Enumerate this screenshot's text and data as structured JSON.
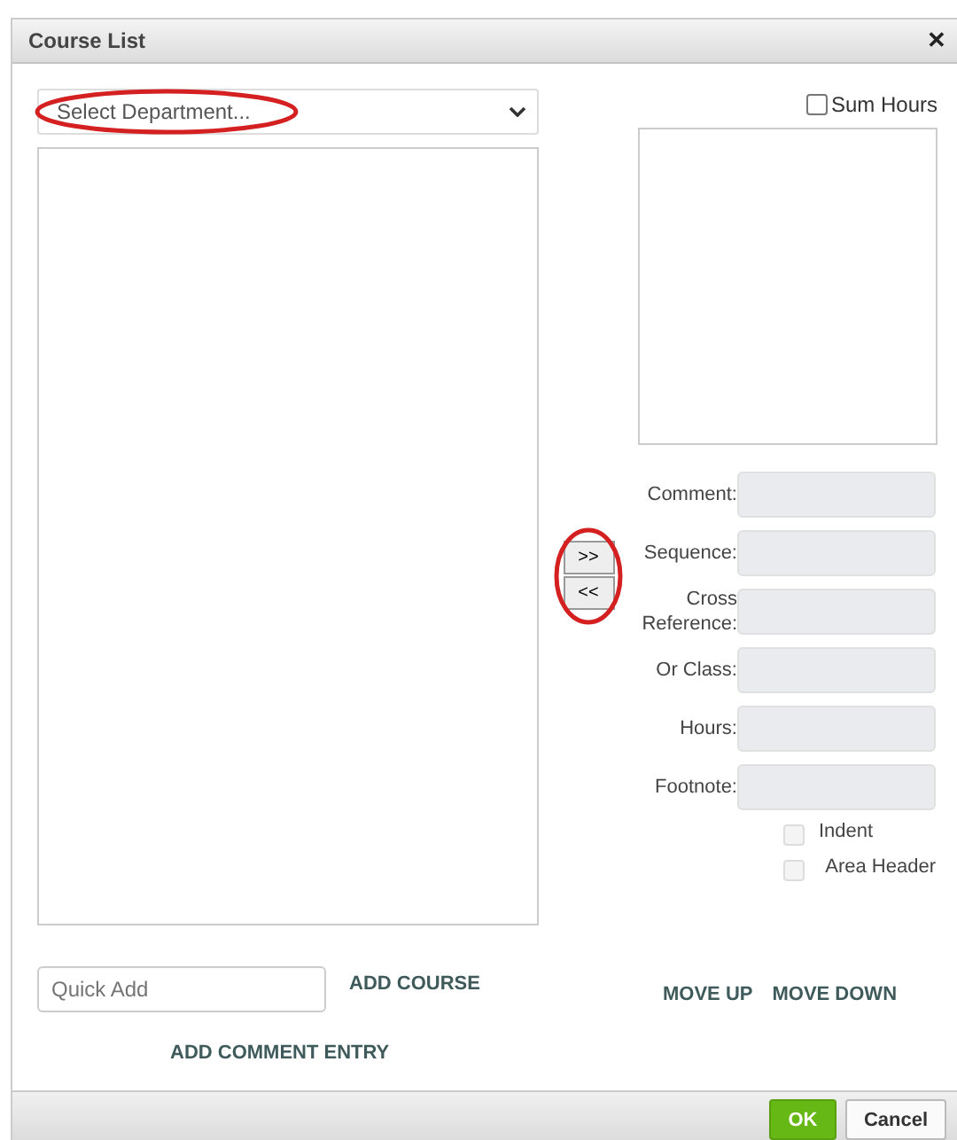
{
  "window": {
    "title": "Course List",
    "close": "✕"
  },
  "department": {
    "placeholder": "Select Department...",
    "circled": true
  },
  "transfer": {
    "buttons": [
      ">>",
      "<<"
    ],
    "circled": true
  },
  "sum_hours": {
    "label": "Sum Hours",
    "checked": false
  },
  "fields": [
    {
      "label": "Comment:"
    },
    {
      "label": "Sequence:"
    },
    {
      "label": "Cross Reference:"
    },
    {
      "label": "Or Class:"
    },
    {
      "label": "Hours:"
    },
    {
      "label": "Footnote:"
    }
  ],
  "options": [
    {
      "label": "Indent",
      "checked": false,
      "disabled": true
    },
    {
      "label": "Area Header",
      "checked": false,
      "disabled": true
    }
  ],
  "quick_add": {
    "placeholder": "Quick Add"
  },
  "links": {
    "add_course": "ADD COURSE",
    "add_comment": "ADD COMMENT ENTRY",
    "move_up": "MOVE UP",
    "move_down": "MOVE DOWN"
  },
  "buttons": [
    {
      "label": "OK",
      "kind": "primary"
    },
    {
      "label": "Cancel",
      "kind": "default"
    }
  ]
}
